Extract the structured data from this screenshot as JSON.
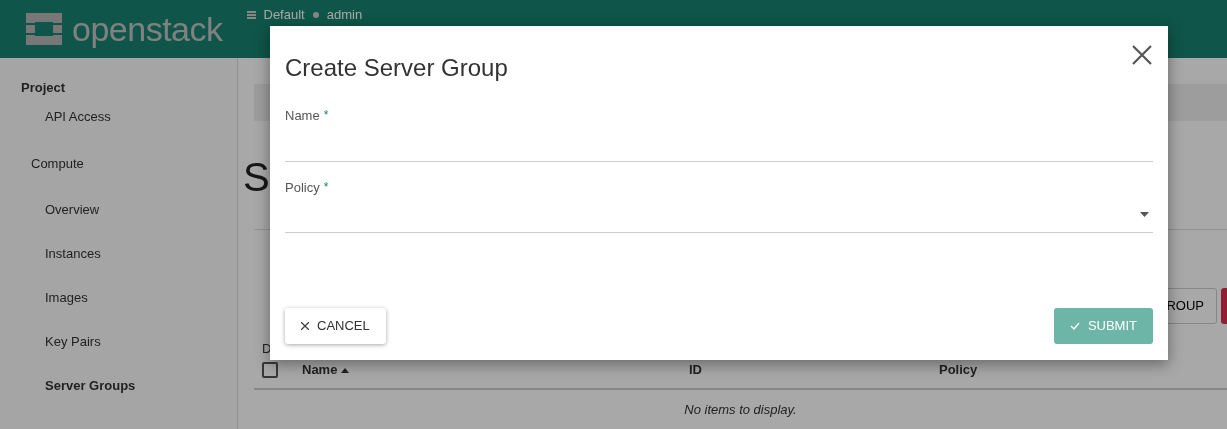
{
  "header": {
    "logo": "openstack",
    "project": "Default",
    "user": "admin"
  },
  "sidebar": {
    "items": [
      {
        "label": "Project",
        "kind": "section",
        "children": [
          {
            "label": "API Access",
            "kind": "link",
            "selected": false
          },
          {
            "label": "Compute",
            "kind": "group",
            "children": [
              {
                "label": "Overview",
                "kind": "link",
                "selected": false
              },
              {
                "label": "Instances",
                "kind": "link",
                "selected": false
              },
              {
                "label": "Images",
                "kind": "link",
                "selected": false
              },
              {
                "label": "Key Pairs",
                "kind": "link",
                "selected": false
              },
              {
                "label": "Server Groups",
                "kind": "link",
                "selected": true
              }
            ]
          }
        ]
      }
    ]
  },
  "main": {
    "page_title": "S",
    "actions": [
      {
        "label": "ROUP",
        "kind": "default"
      },
      {
        "kind": "danger"
      }
    ],
    "table": {
      "info": "D",
      "select_all": {
        "checked": false
      },
      "columns": [
        {
          "label": "Name",
          "sorted": true
        },
        {
          "label": "ID",
          "sorted": false
        },
        {
          "label": "Policy",
          "sorted": false
        }
      ],
      "empty_message": "No items to display."
    }
  },
  "modal": {
    "title": "Create Server Group",
    "fields": [
      {
        "label": "Name",
        "required": true,
        "required_mark": "*",
        "kind": "text"
      },
      {
        "label": "Policy",
        "required": true,
        "required_mark": "*",
        "kind": "select"
      }
    ],
    "buttons": [
      {
        "label": "CANCEL",
        "kind": "cancel"
      },
      {
        "label": "SUBMIT",
        "kind": "submit"
      }
    ]
  }
}
